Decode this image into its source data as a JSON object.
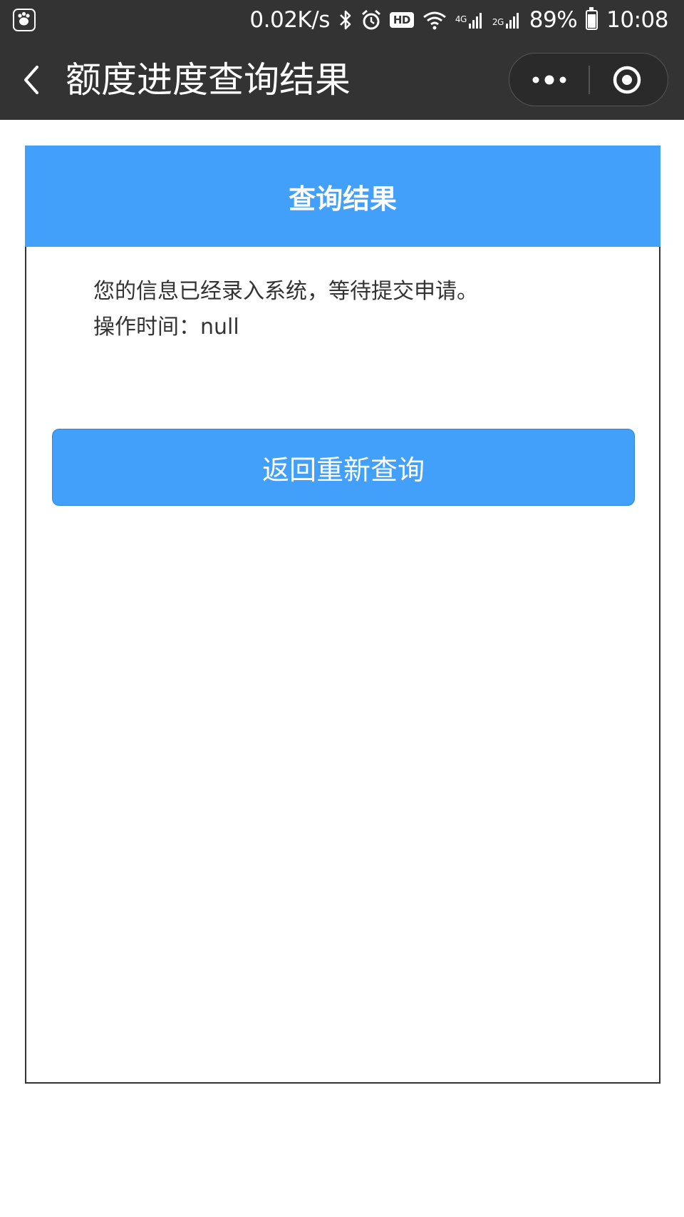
{
  "status_bar": {
    "net_speed": "0.02K/s",
    "hd_label": "HD",
    "net_4g": "4G",
    "net_2g": "2G",
    "battery": "89%",
    "time": "10:08",
    "battery_level": 0.89
  },
  "nav": {
    "title": "额度进度查询结果"
  },
  "card": {
    "header_title": "查询结果",
    "message": "您的信息已经录入系统，等待提交申请。",
    "operation_time": "操作时间：null",
    "retry_label": "返回重新查询"
  },
  "colors": {
    "header_bg": "#333333",
    "accent_blue": "#42a0fa",
    "text_dark": "#333333"
  }
}
